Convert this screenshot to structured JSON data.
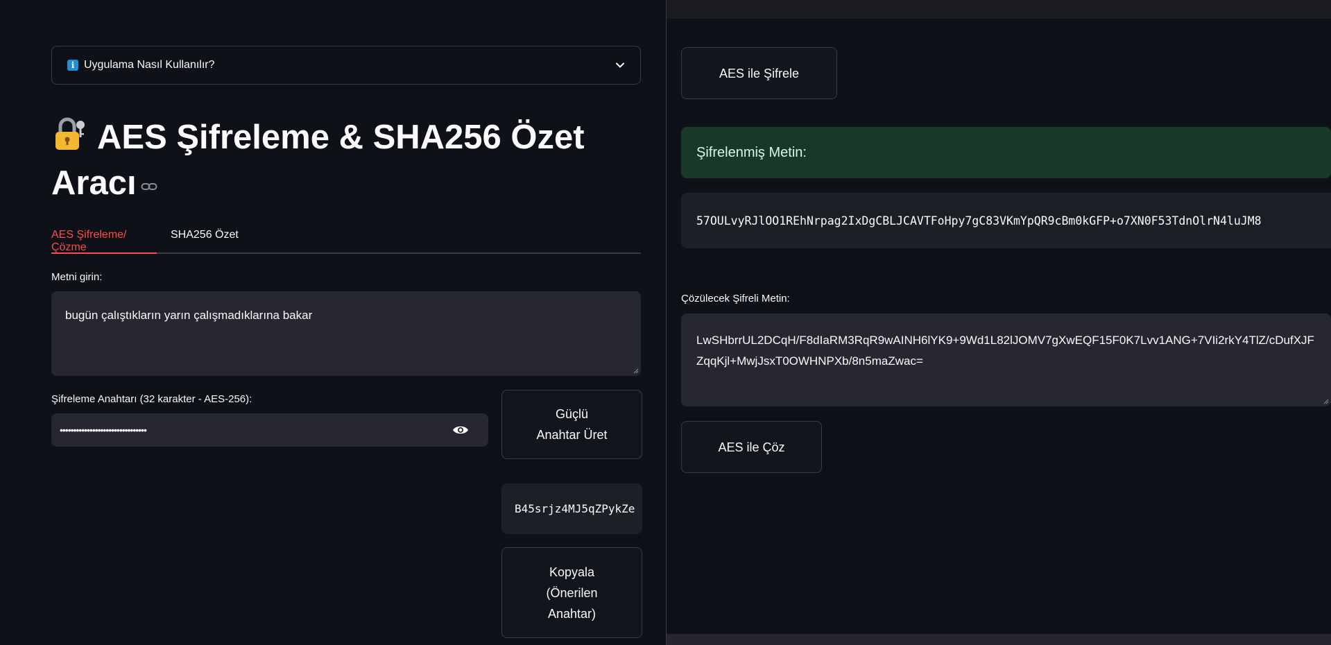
{
  "expander": {
    "label": "Uygulama Nasıl Kullanılır?",
    "icon": "info-icon"
  },
  "title": {
    "text": "AES Şifreleme & SHA256 Özet Aracı"
  },
  "tabs": [
    {
      "label": "AES Şifreleme/Çözme",
      "active": true
    },
    {
      "label": "SHA256 Özet",
      "active": false
    }
  ],
  "input_text": {
    "label": "Metni girin:",
    "value": "bugün çalıştıkların yarın çalışmadıklarına bakar"
  },
  "key_field": {
    "label": "Şifreleme Anahtarı (32 karakter - AES-256):",
    "value": "••••••••••••••••••••••••••••••••"
  },
  "buttons": {
    "generate_line1": "Güçlü",
    "generate_line2": "Anahtar Üret",
    "copy_line1": "Kopyala",
    "copy_line2": "(Önerilen",
    "copy_line3": "Anahtar)",
    "encrypt": "AES ile Şifrele",
    "decrypt": "AES ile Çöz"
  },
  "suggested_key": "B45srjz4MJ5qZPykZe",
  "encrypted": {
    "heading": "Şifrelenmiş Metin:",
    "value": "57OULvyRJlOO1REhNrpag2IxDgCBLJCAVTFoHpy7gC83VKmYpQR9cBm0kGFP+o7XN0F53TdnOlrN4luJM8"
  },
  "decrypt_input": {
    "label": "Çözülecek Şifreli Metin:",
    "value": "LwSHbrrUL2DCqH/F8dIaRM3RqR9wAINH6lYK9+9Wd1L82lJOMV7gXwEQF15F0K7Lvv1ANG+7VIi2rkY4TlZ/cDufXJFZqqKjl+MwjJsxT0OWHNPXb/8n5maZwac="
  },
  "colors": {
    "accent": "#ff4b4b",
    "success_bg": "#173928",
    "background": "#0e1117",
    "input_bg": "#262730"
  }
}
